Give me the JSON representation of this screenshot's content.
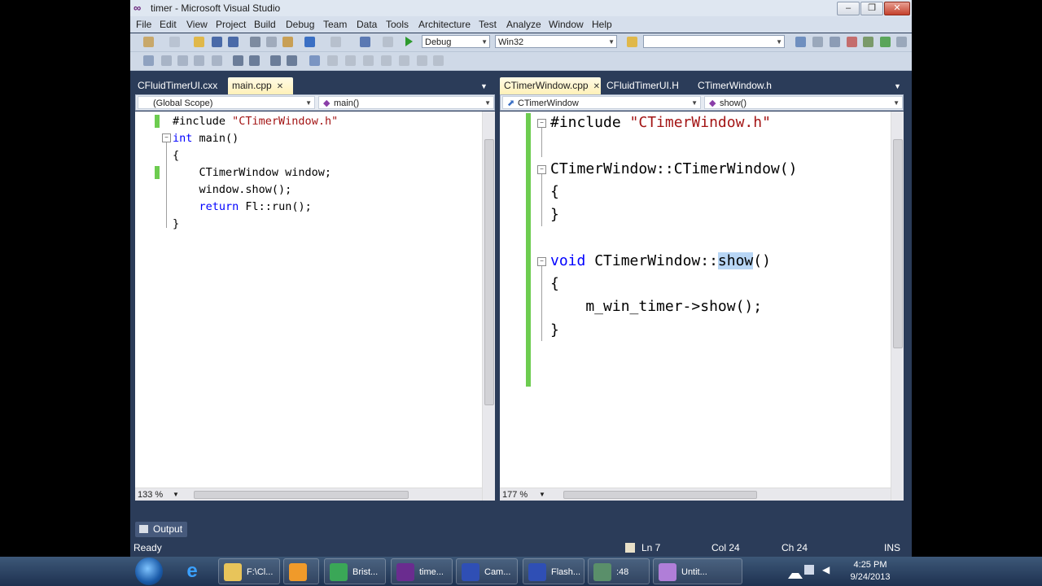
{
  "window": {
    "title": "timer - Microsoft Visual Studio",
    "caption_minimize": "‒",
    "caption_maximize": "❐",
    "caption_close": "✕"
  },
  "menu": [
    "File",
    "Edit",
    "View",
    "Project",
    "Build",
    "Debug",
    "Team",
    "Data",
    "Tools",
    "Architecture",
    "Test",
    "Analyze",
    "Window",
    "Help"
  ],
  "toolbar": {
    "config": "Debug",
    "platform": "Win32",
    "find_value": ""
  },
  "left_pane": {
    "tabs": [
      "CFluidTimerUI.cxx",
      "main.cpp"
    ],
    "active_tab": "main.cpp",
    "scope": "(Global Scope)",
    "member": "main()",
    "zoom": "133 %",
    "code": [
      {
        "parts": [
          {
            "t": "#include ",
            "c": ""
          },
          {
            "t": "\"CTimerWindow.h\"",
            "c": "str"
          }
        ]
      },
      {
        "parts": [
          {
            "t": "int",
            "c": "kw"
          },
          {
            "t": " main()",
            "c": ""
          }
        ]
      },
      {
        "parts": [
          {
            "t": "{",
            "c": ""
          }
        ]
      },
      {
        "parts": [
          {
            "t": "    CTimerWindow window;",
            "c": ""
          }
        ]
      },
      {
        "parts": [
          {
            "t": "    window.show();",
            "c": ""
          }
        ]
      },
      {
        "parts": [
          {
            "t": "    ",
            "c": ""
          },
          {
            "t": "return",
            "c": "kw"
          },
          {
            "t": " Fl::run();",
            "c": ""
          }
        ]
      },
      {
        "parts": [
          {
            "t": "}",
            "c": ""
          }
        ]
      }
    ]
  },
  "right_pane": {
    "tabs": [
      "CTimerWindow.cpp",
      "CFluidTimerUI.H",
      "CTimerWindow.h"
    ],
    "active_tab": "CTimerWindow.cpp",
    "scope": "CTimerWindow",
    "member": "show()",
    "zoom": "177 %",
    "code": [
      {
        "parts": [
          {
            "t": "#include ",
            "c": ""
          },
          {
            "t": "\"CTimerWindow.h\"",
            "c": "str"
          }
        ]
      },
      {
        "parts": [
          {
            "t": "",
            "c": ""
          }
        ]
      },
      {
        "parts": [
          {
            "t": "CTimerWindow::CTimerWindow()",
            "c": ""
          }
        ]
      },
      {
        "parts": [
          {
            "t": "{",
            "c": ""
          }
        ]
      },
      {
        "parts": [
          {
            "t": "}",
            "c": ""
          }
        ]
      },
      {
        "parts": [
          {
            "t": "",
            "c": ""
          }
        ]
      },
      {
        "parts": [
          {
            "t": "void",
            "c": "kw"
          },
          {
            "t": " CTimerWindow::",
            "c": ""
          },
          {
            "t": "show",
            "c": "sel"
          },
          {
            "t": "()",
            "c": ""
          }
        ]
      },
      {
        "parts": [
          {
            "t": "{",
            "c": ""
          }
        ]
      },
      {
        "parts": [
          {
            "t": "    m_win_timer->show();",
            "c": ""
          }
        ]
      },
      {
        "parts": [
          {
            "t": "}",
            "c": ""
          }
        ]
      }
    ]
  },
  "output_tab": "Output",
  "status": {
    "state": "Ready",
    "line": "Ln 7",
    "col": "Col 24",
    "ch": "Ch 24",
    "mode": "INS"
  },
  "taskbar": {
    "items": [
      {
        "label": "F:\\Cl...",
        "color": "#e8c45a"
      },
      {
        "label": "",
        "color": "#f09a2a"
      },
      {
        "label": "Brist...",
        "color": "#3aa757"
      },
      {
        "label": "time...",
        "color": "#6a2c8f"
      },
      {
        "label": "Cam...",
        "color": "#2f4fb5"
      },
      {
        "label": "Flash...",
        "color": "#2f4fb5"
      },
      {
        "label": ":48",
        "color": "#5a8f6a"
      },
      {
        "label": "Untit...",
        "color": "#b07ed8"
      }
    ],
    "time": "4:25 PM",
    "date": "9/24/2013"
  }
}
